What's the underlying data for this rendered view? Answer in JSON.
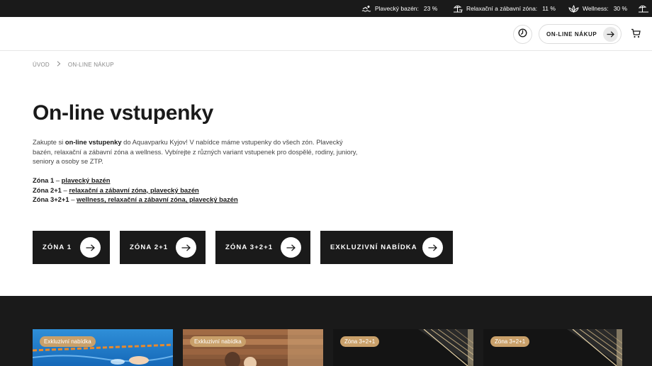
{
  "topbar": {
    "occupancy": [
      {
        "icon": "swimmer-icon",
        "label": "Plavecký bazén:",
        "value": "23 %"
      },
      {
        "icon": "beach-umbrella-icon",
        "label": "Relaxační a zábavní zóna:",
        "value": "11 %"
      },
      {
        "icon": "lotus-icon",
        "label": "Wellness:",
        "value": "30 %"
      }
    ]
  },
  "header": {
    "clock_icon": "clock-icon",
    "shop_label": "ON-LINE NÁKUP",
    "cart_icon": "cart-icon"
  },
  "breadcrumb": {
    "items": [
      "ÚVOD",
      "ON-LINE NÁKUP"
    ]
  },
  "page": {
    "title": "On-line vstupenky",
    "intro_pre": "Zakupte si ",
    "intro_bold": "on-line vstupenky",
    "intro_post": " do Aquavparku Kyjov! V nabídce máme vstupenky do všech zón. Plavecký bazén, relaxační a zábavní zóna a wellness. Vybírejte z různých variant vstupenek pro dospělé, rodiny, juniory, seniory a osoby se ZTP."
  },
  "zones": [
    {
      "name": "Zóna 1",
      "sep": " – ",
      "link": "plavecký bazén"
    },
    {
      "name": "Zóna 2+1",
      "sep": " – ",
      "link": "relaxační a zábavní zóna, plavecký bazén"
    },
    {
      "name": "Zóna 3+2+1",
      "sep": " – ",
      "link": "wellness, relaxační a zábavní zóna, plavecký bazén"
    }
  ],
  "buttons": [
    {
      "label": "ZÓNA 1"
    },
    {
      "label": "ZÓNA 2+1"
    },
    {
      "label": "ZÓNA 3+2+1"
    },
    {
      "label": "EXKLUZIVNÍ NABÍDKA"
    }
  ],
  "cards": [
    {
      "badge": "Exkluzivní nabídka"
    },
    {
      "badge": "Exkluzivní nabídka"
    },
    {
      "badge": "Zóna 3+2+1"
    },
    {
      "badge": "Zóna 3+2+1"
    }
  ],
  "colors": {
    "dark": "#1a1a1a",
    "badge": "#c9a06a",
    "link": "#1a1a1a"
  }
}
